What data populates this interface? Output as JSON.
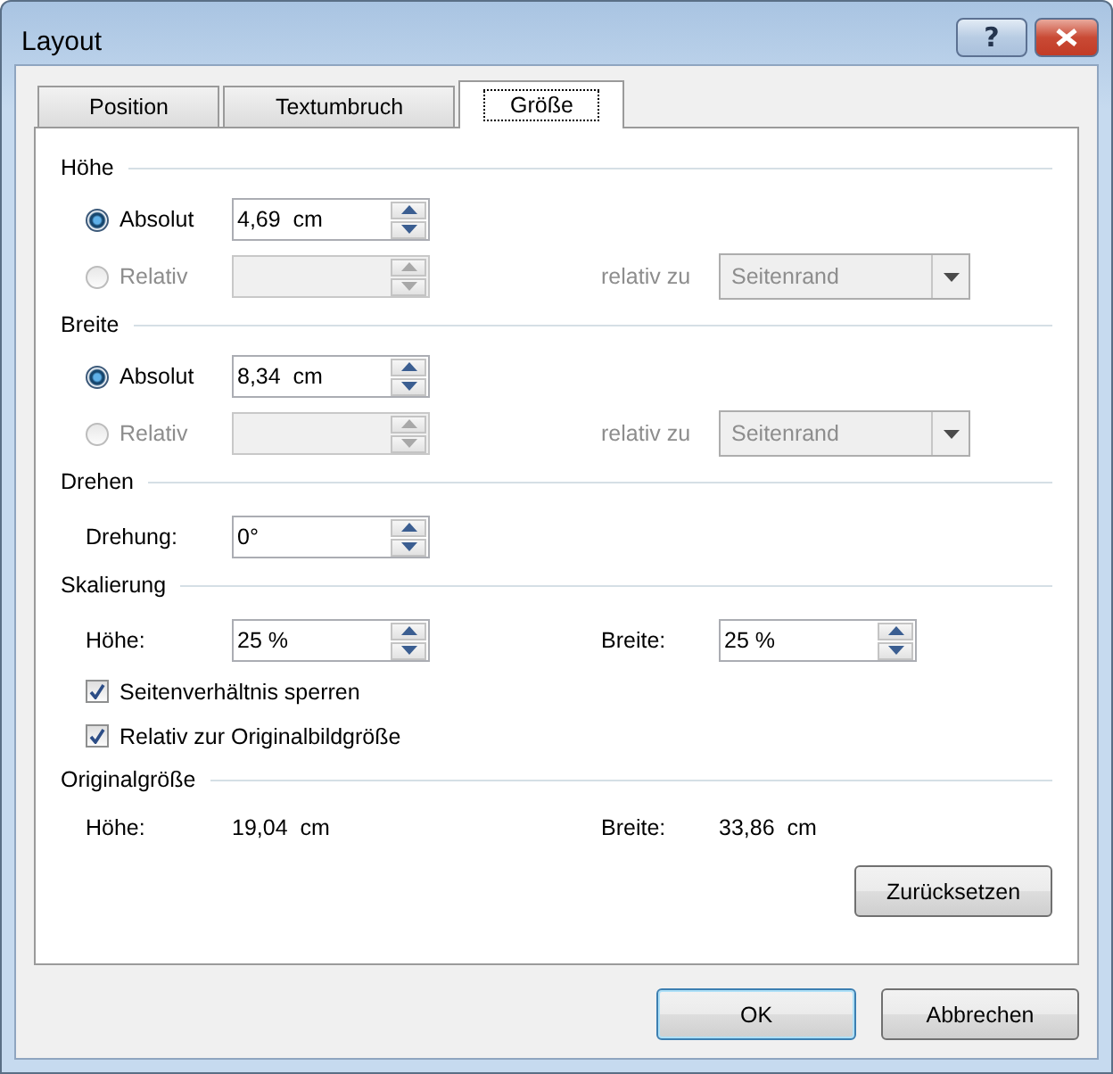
{
  "window": {
    "title": "Layout",
    "help": "?"
  },
  "tabs": [
    {
      "label": "Position",
      "selected": false
    },
    {
      "label": "Textumbruch",
      "selected": false
    },
    {
      "label": "Größe",
      "selected": true
    }
  ],
  "sections": [
    {
      "kind": "size",
      "title": "Höhe",
      "options": [
        {
          "label": "Absolut",
          "selected": true,
          "disabled": false,
          "value": "4,69  cm"
        },
        {
          "label": "Relativ",
          "selected": false,
          "disabled": true
        }
      ],
      "relative_to": {
        "label": "relativ zu",
        "value": "Seitenrand",
        "disabled": true
      }
    },
    {
      "kind": "size",
      "title": "Breite",
      "options": [
        {
          "label": "Absolut",
          "selected": true,
          "disabled": false,
          "value": "8,34  cm"
        },
        {
          "label": "Relativ",
          "selected": false,
          "disabled": true
        }
      ],
      "relative_to": {
        "label": "relativ zu",
        "value": "Seitenrand",
        "disabled": true
      }
    },
    {
      "kind": "rotation",
      "title": "Drehen",
      "label": "Drehung:",
      "value": "0°"
    },
    {
      "kind": "scale",
      "title": "Skalierung",
      "height": {
        "label": "Höhe:",
        "value": "25 %"
      },
      "width": {
        "label": "Breite:",
        "value": "25 %"
      },
      "checkboxes": [
        {
          "label": "Seitenverhältnis sperren",
          "checked": true
        },
        {
          "label": "Relativ zur Originalbildgröße",
          "checked": true
        }
      ]
    },
    {
      "kind": "original",
      "title": "Originalgröße",
      "height": {
        "label": "Höhe:",
        "value": "19,04  cm"
      },
      "width": {
        "label": "Breite:",
        "value": "33,86  cm"
      },
      "reset": "Zurücksetzen"
    }
  ],
  "buttons": [
    {
      "label": "OK",
      "default": true
    },
    {
      "label": "Abbrechen",
      "default": false
    }
  ]
}
